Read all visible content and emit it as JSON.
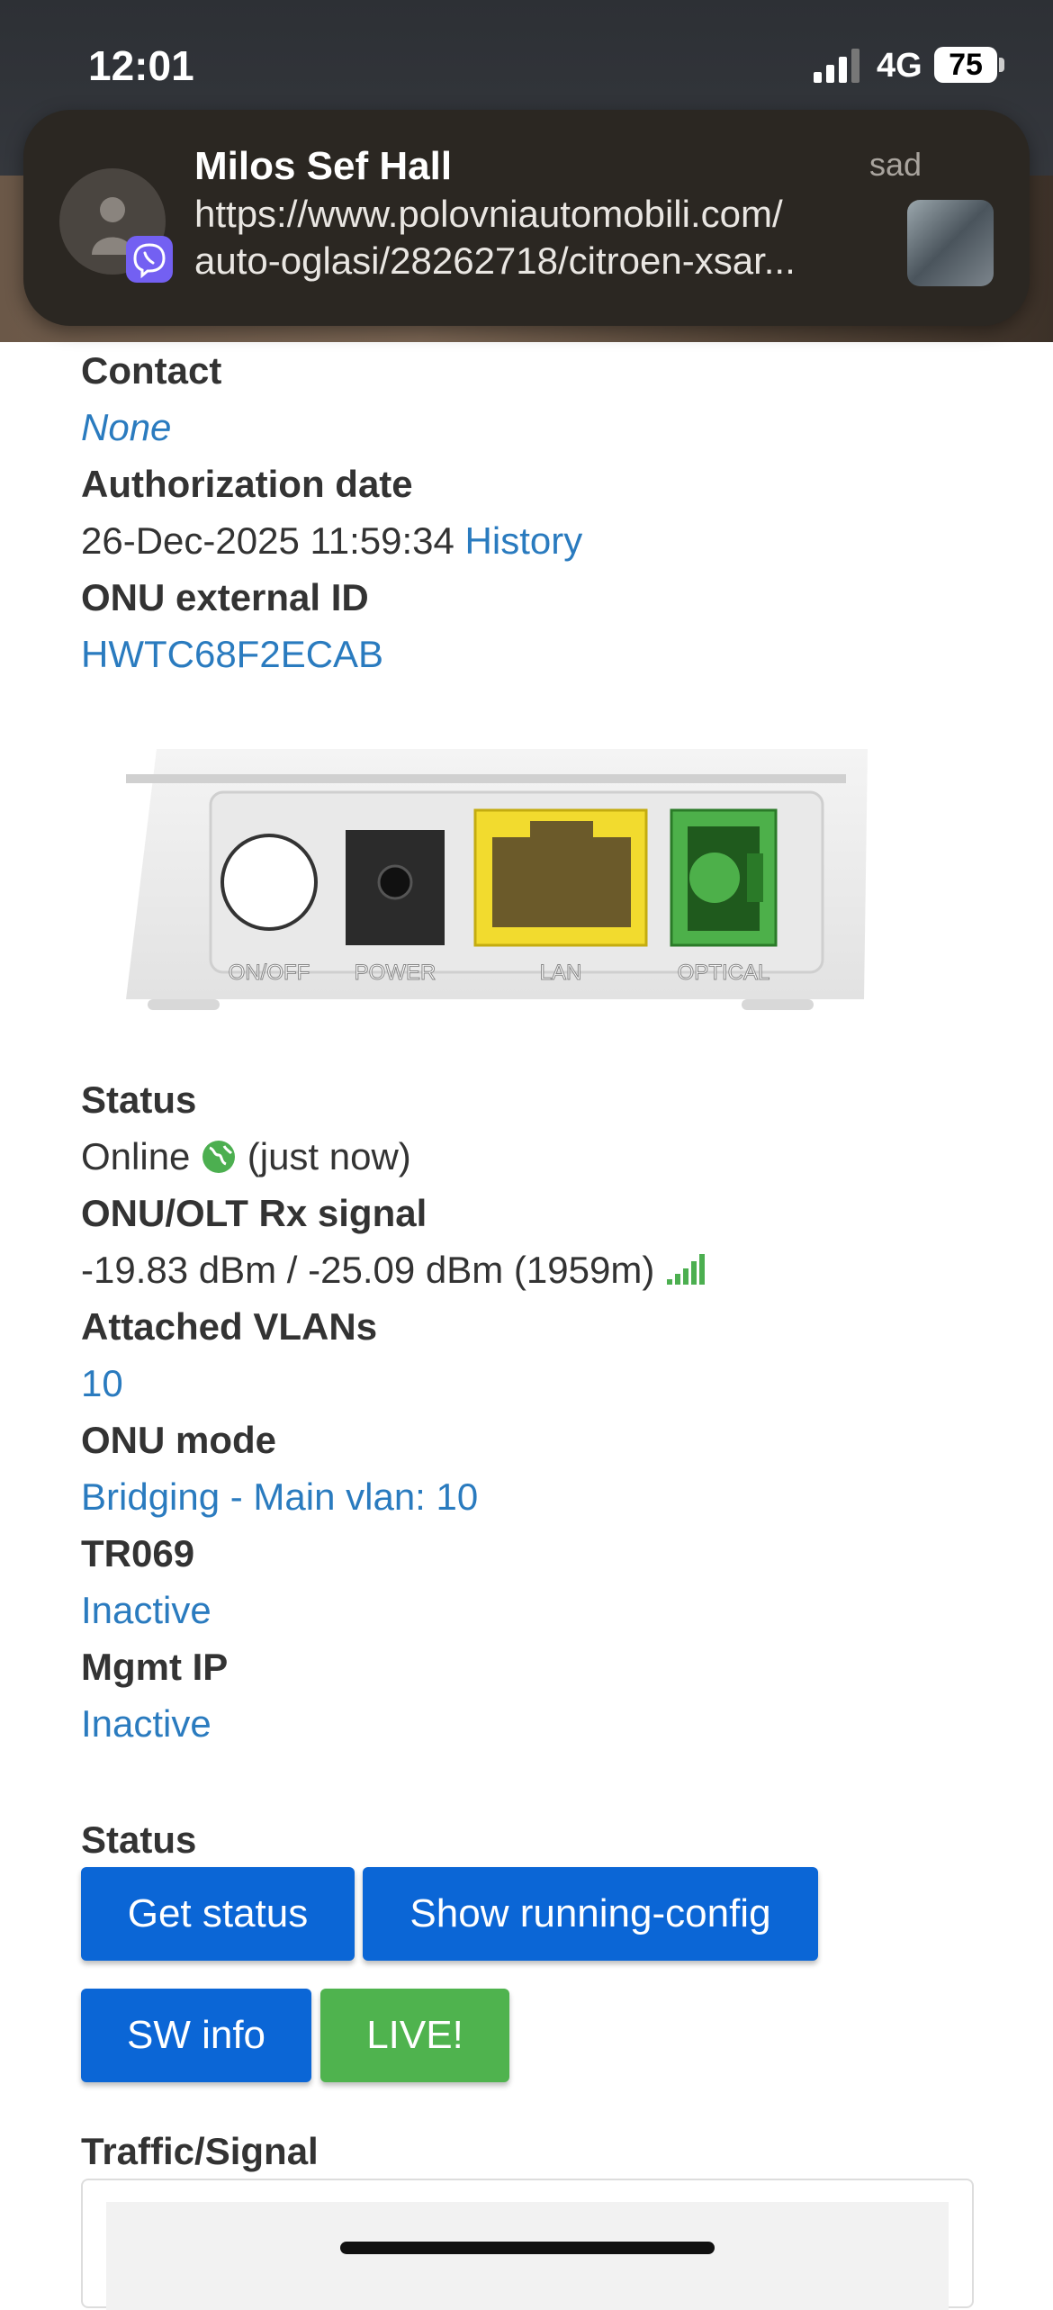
{
  "status_bar": {
    "time": "12:01",
    "network": "4G",
    "battery": "75"
  },
  "notification": {
    "sender": "Milos Sef Hall",
    "time": "sad",
    "line1": "https://www.polovniautomobili.com/",
    "line2": "auto-oglasi/28262718/citroen-xsar...",
    "app_icon": "viber-icon"
  },
  "details": {
    "contact_label": "Contact",
    "contact_value": "None",
    "auth_label": "Authorization date",
    "auth_value": "26-Dec-2025 11:59:34",
    "history_link": "History",
    "ext_id_label": "ONU external ID",
    "ext_id_value": "HWTC68F2ECAB"
  },
  "device_ports": [
    "ON/OFF",
    "POWER",
    "LAN",
    "OPTICAL"
  ],
  "info": {
    "status_label": "Status",
    "status_value": "Online",
    "status_note": "(just now)",
    "signal_label": "ONU/OLT Rx signal",
    "signal_value": "-19.83 dBm / -25.09 dBm (1959m)",
    "vlans_label": "Attached VLANs",
    "vlans_value": "10",
    "mode_label": "ONU mode",
    "mode_value": "Bridging - Main vlan: 10",
    "tr069_label": "TR069",
    "tr069_value": "Inactive",
    "mgmt_label": "Mgmt IP",
    "mgmt_value": "Inactive"
  },
  "actions": {
    "section_label": "Status",
    "get_status": "Get status",
    "running_config": "Show running-config",
    "sw_info": "SW info",
    "live": "LIVE!"
  },
  "traffic": {
    "label": "Traffic/Signal"
  },
  "colors": {
    "link": "#2a7bbf",
    "primary": "#0b66d6",
    "success": "#4fb34e",
    "online": "#4caf50"
  }
}
